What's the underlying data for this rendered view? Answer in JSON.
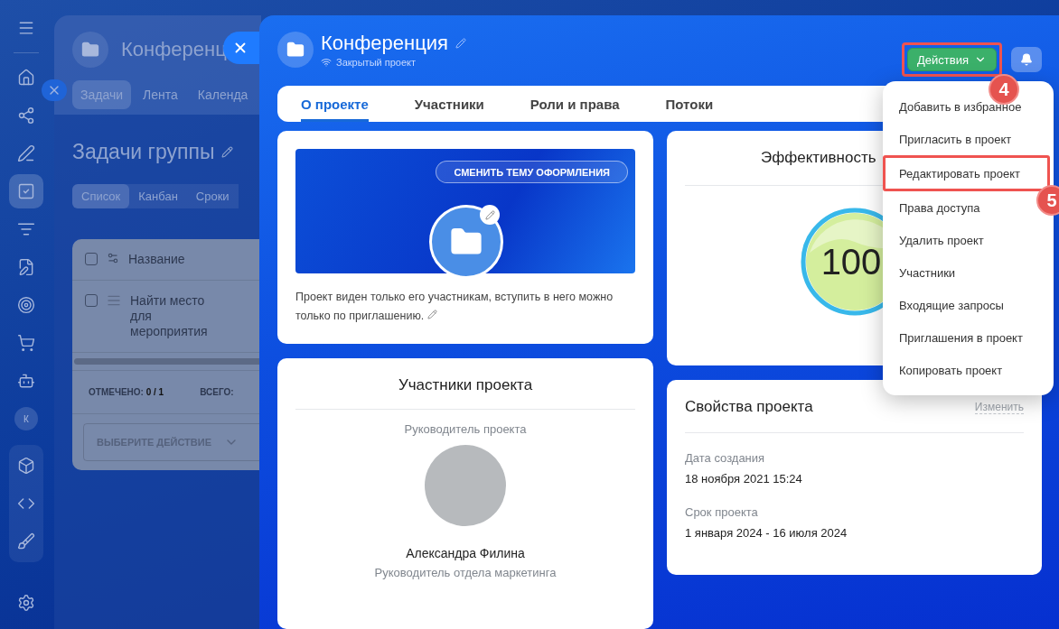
{
  "sidebar": {
    "items": [
      {
        "kind": "menu",
        "selected": false
      },
      {
        "kind": "home",
        "selected": false
      },
      {
        "kind": "nodes",
        "selected": false
      },
      {
        "kind": "pen",
        "selected": false
      },
      {
        "kind": "tasks",
        "selected": true
      },
      {
        "kind": "funnel",
        "selected": false
      },
      {
        "kind": "document",
        "selected": false
      },
      {
        "kind": "target",
        "selected": false
      },
      {
        "kind": "cart",
        "selected": false
      },
      {
        "kind": "robot",
        "selected": false
      },
      {
        "kind": "avatar",
        "selected": false,
        "text": "К"
      },
      {
        "kind": "cube",
        "selected": false
      },
      {
        "kind": "code",
        "selected": false
      },
      {
        "kind": "brushes",
        "selected": false
      },
      {
        "kind": "settings",
        "selected": false
      }
    ]
  },
  "background_page": {
    "title": "Конференц",
    "tabs": [
      {
        "label": "Задачи",
        "selected": true
      },
      {
        "label": "Лента",
        "selected": false
      },
      {
        "label": "Календа",
        "selected": false
      }
    ],
    "heading": "Задачи группы",
    "view_tabs": [
      {
        "label": "Список",
        "selected": true
      },
      {
        "label": "Канбан",
        "selected": false
      },
      {
        "label": "Сроки",
        "selected": false
      }
    ],
    "table": {
      "header_checked": false,
      "columns": [
        "Название"
      ],
      "rows": [
        {
          "title": "Найти место для мероприятия",
          "checked": false
        }
      ]
    },
    "footer": {
      "marked_label": "ОТМЕЧЕНО:",
      "marked_value": "0 / 1",
      "total_label": "ВСЕГО:"
    },
    "action_select": "ВЫБЕРИТЕ ДЕЙСТВИЕ"
  },
  "project": {
    "title": "Конференция",
    "subtitle": "Закрытый проект",
    "actions_button": {
      "label": "Действия",
      "step": "4"
    },
    "tabs": [
      {
        "label": "О проекте",
        "selected": true
      },
      {
        "label": "Участники",
        "selected": false
      },
      {
        "label": "Роли и права",
        "selected": false
      },
      {
        "label": "Потоки",
        "selected": false
      }
    ],
    "cover": {
      "theme_button": "СМЕНИТЬ ТЕМУ ОФОРМЛЕНИЯ",
      "description": "Проект виден только его участникам, вступить в него можно только по приглашению."
    },
    "efficiency": {
      "title": "Эффективность",
      "value": "100"
    },
    "members": {
      "title": "Участники проекта",
      "role_label": "Руководитель проекта",
      "name": "Александра Филина",
      "position": "Руководитель отдела маркетинга"
    },
    "properties": {
      "title": "Свойства проекта",
      "edit_link": "Изменить",
      "fields": [
        {
          "label": "Дата создания",
          "value": "18 ноября 2021 15:24"
        },
        {
          "label": "Срок проекта",
          "value": "1 января 2024 - 16 июля 2024"
        }
      ]
    }
  },
  "actions_menu": {
    "items": [
      {
        "label": "Добавить в избранное"
      },
      {
        "label": "Пригласить в проект"
      },
      {
        "label": "Редактировать проект",
        "step": "5"
      },
      {
        "label": "Права доступа"
      },
      {
        "label": "Удалить проект"
      },
      {
        "label": "Участники"
      },
      {
        "label": "Входящие запросы"
      },
      {
        "label": "Приглашения в проект"
      },
      {
        "label": "Копировать проект"
      }
    ]
  }
}
